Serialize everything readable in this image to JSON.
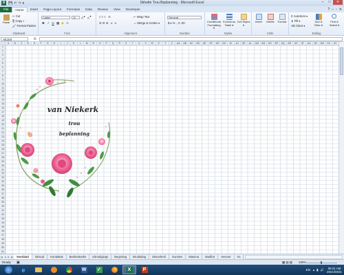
{
  "window": {
    "title": "Skhatte Trou Beplanning - Microsoft Excel",
    "app_letter": "X",
    "controls": [
      "–",
      "□",
      "✕"
    ]
  },
  "ribbon_tabs": [
    "File",
    "Home",
    "Insert",
    "Page Layout",
    "Formulas",
    "Data",
    "Review",
    "View",
    "Developer"
  ],
  "active_tab": "Home",
  "ribbon": {
    "clipboard": {
      "paste": "Paste",
      "cut": "Cut",
      "copy": "Copy ▾",
      "format_painter": "Format Painter",
      "label": "Clipboard"
    },
    "font": {
      "name": "Calibri",
      "size": "11",
      "label": "Font",
      "bold": "B",
      "italic": "I",
      "underline": "U"
    },
    "alignment": {
      "wrap": "Wrap Text",
      "merge": "Merge & Center ▾",
      "label": "Alignment"
    },
    "number": {
      "format": "General",
      "currency": "$",
      "percent": "%",
      "comma": ",",
      "label": "Number"
    },
    "styles": {
      "conditional": "Conditional Formatting ▾",
      "format_table": "Format as Table ▾",
      "cell_styles": "Cell Styles ▾",
      "label": "Styles"
    },
    "cells": {
      "insert": "Insert",
      "delete": "Delete",
      "format": "Format",
      "label": "Cells"
    },
    "editing": {
      "autosum": "AutoSum ▾",
      "fill": "Fill ▾",
      "clear": "Clear ▾",
      "sort": "Sort & Filter ▾",
      "find": "Find & Select ▾",
      "label": "Editing"
    }
  },
  "formula_bar": {
    "name_box": "AE104",
    "fx": "fx",
    "value": ""
  },
  "columns": [
    "A",
    "B",
    "C",
    "D",
    "E",
    "F",
    "G",
    "H",
    "I",
    "J",
    "K",
    "L",
    "M",
    "N",
    "O",
    "P",
    "Q",
    "R",
    "S",
    "T",
    "U",
    "V",
    "W",
    "X",
    "Y",
    "Z",
    "AA",
    "AB",
    "AC",
    "AD",
    "AE",
    "AF",
    "AG",
    "AH",
    "AI",
    "AJ",
    "AK",
    "AL",
    "AM",
    "AN",
    "AO",
    "AP",
    "AQ",
    "AR",
    "AS",
    "AT",
    "AU",
    "AV",
    "AW",
    "AX",
    "AY"
  ],
  "wreath": {
    "line1": "van Niekerk",
    "line2": "trou",
    "line3": "beplanning",
    "accent": "#e8467c"
  },
  "sheet_tabs": [
    "Voorblad",
    "Skroud",
    "Kontaktas",
    "Beshedeaths",
    "Uitnodigings",
    "Begroting",
    "Bruidsdag",
    "Skoonheid",
    "Gunsies",
    "Manima",
    "Madfryt",
    "Vervoer",
    "Vo"
  ],
  "active_sheet": "Voorblad",
  "status": {
    "ready": "Ready",
    "zoom": "100%"
  },
  "taskbar": {
    "apps": [
      "start",
      "ie",
      "explorer",
      "media",
      "chrome",
      "word",
      "excel-green",
      "firefox",
      "powerpoint"
    ],
    "active_app": "excel",
    "lang": "EN",
    "time": "08:41 AM",
    "date": "2021/03/21"
  },
  "colors": {
    "title_bar": "#dfe9f5",
    "ribbon": "#e4ecf7",
    "file_tab": "#1d6b3d",
    "taskbar": "#1f4d7a",
    "rose": "#ec5a8c",
    "leaf": "#3f8f3f"
  }
}
